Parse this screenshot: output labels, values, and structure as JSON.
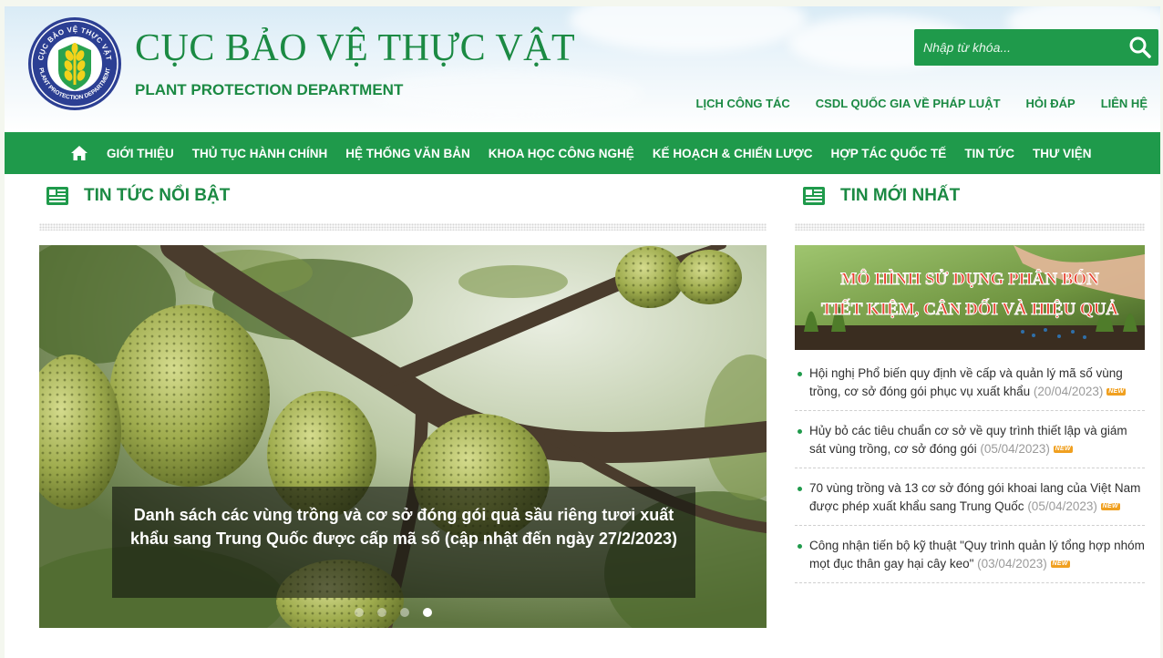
{
  "header": {
    "title": "CỤC BẢO VỆ THỰC VẬT",
    "subtitle": "PLANT PROTECTION DEPARTMENT",
    "logo_text_top": "CỤC BẢO VỆ THỰC VẬT",
    "logo_text_bottom": "PLANT PROTECTION DEPARTMENT",
    "search_placeholder": "Nhập từ khóa...",
    "top_links": [
      "LỊCH CÔNG TÁC",
      "CSDL QUỐC GIA VỀ PHÁP LUẬT",
      "HỎI ĐÁP",
      "LIÊN HỆ"
    ]
  },
  "nav": {
    "items": [
      "GIỚI THIỆU",
      "THỦ TỤC HÀNH CHÍNH",
      "HỆ THỐNG VĂN BẢN",
      "KHOA HỌC CÔNG NGHỆ",
      "KẾ HOẠCH & CHIẾN LƯỢC",
      "HỢP TÁC QUỐC TẾ",
      "TIN TỨC",
      "THƯ VIỆN"
    ]
  },
  "featured": {
    "heading": "TIN TỨC NỔI BẬT",
    "caption": "Danh sách các vùng trồng và cơ sở đóng gói quả sầu riêng tươi xuất khẩu sang Trung Quốc được cấp mã số (cập nhật đến ngày 27/2/2023)",
    "slide_count": 4,
    "active_slide": 4
  },
  "latest": {
    "heading": "TIN MỚI NHẤT",
    "banner_line1": "MÔ HÌNH SỬ DỤNG PHÂN BÓN",
    "banner_line2": "TIẾT KIỆM, CÂN ĐỐI VÀ HIỆU QUẢ",
    "new_label": "NEW",
    "items": [
      {
        "text": "Hội nghị Phổ biến quy định về cấp và quản lý mã số vùng trồng, cơ sở đóng gói phục vụ xuất khẩu",
        "date": "(20/04/2023)"
      },
      {
        "text": "Hủy bỏ các tiêu chuẩn cơ sở về quy trình thiết lập và giám sát vùng trồng, cơ sở đóng gói",
        "date": "(05/04/2023)"
      },
      {
        "text": "70 vùng trồng và 13 cơ sở đóng gói khoai lang của Việt Nam được phép xuất khẩu sang Trung Quốc",
        "date": "(05/04/2023)"
      },
      {
        "text": "Công nhận tiến bộ kỹ thuật \"Quy trình quản lý tổng hợp nhóm mọt đục thân gay hại cây keo\"",
        "date": "(03/04/2023)"
      }
    ]
  },
  "colors": {
    "brand_green": "#1f9a4b",
    "title_green": "#1b8a43",
    "badge_orange": "#f0a020"
  }
}
